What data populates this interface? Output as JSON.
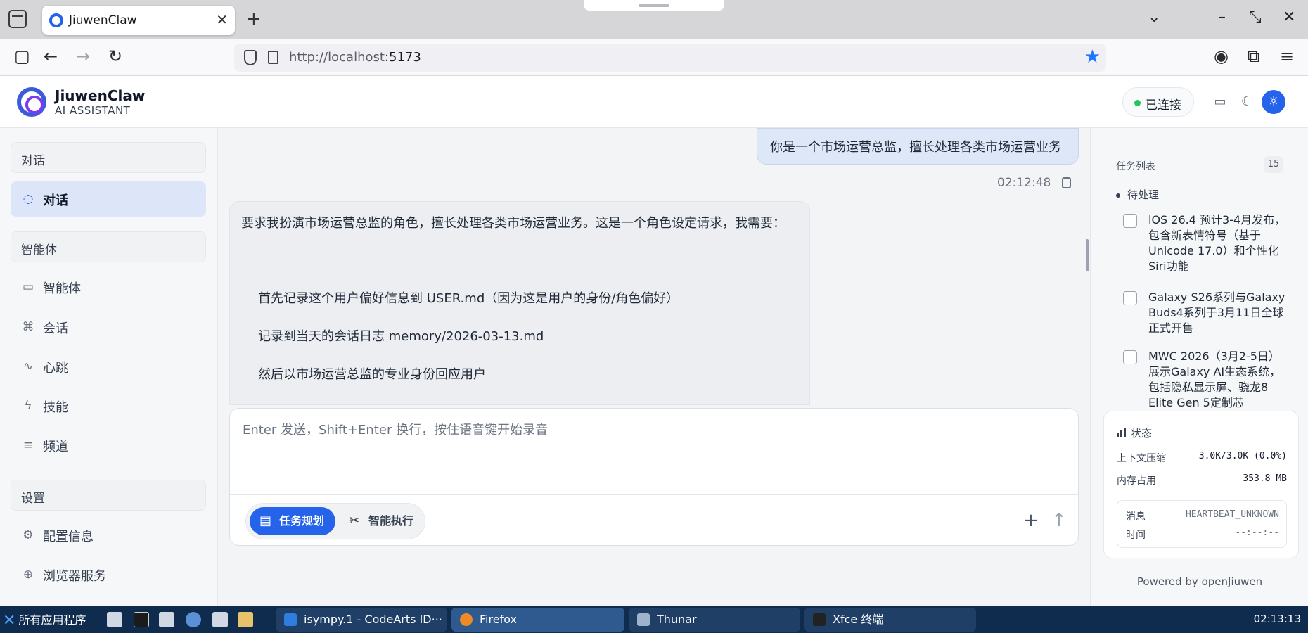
{
  "browser": {
    "tab_title": "JiuwenClaw",
    "url_host": "http://localhost",
    "url_port": ":5173"
  },
  "header": {
    "brand": "JiuwenClaw",
    "brand_sub": "AI ASSISTANT",
    "connection_status": "已连接",
    "status_color": "#22c55e",
    "accent_color": "#2563eb"
  },
  "sidebar": {
    "section_chat": "对话",
    "chat_item": "对话",
    "section_agents": "智能体",
    "agent_items": [
      "智能体",
      "会话",
      "心跳",
      "技能",
      "频道"
    ],
    "section_settings": "设置",
    "settings_items": [
      "配置信息",
      "浏览器服务"
    ]
  },
  "chat": {
    "user_message": "你是一个市场运营总监，擅长处理各类市场运营业务",
    "user_message_time": "02:12:48",
    "assistant_lines": [
      "要求我扮演市场运营总监的角色，擅长处理各类市场运营业务。这是一个角色设定请求，我需要：",
      "首先记录这个用户偏好信息到 USER.md（因为这是用户的身份/角色偏好）",
      "记录到当天的会话日志 memory/2026-03-13.md",
      "然后以市场运营总监的专业身份回应用户"
    ]
  },
  "composer": {
    "placeholder": "Enter 发送，Shift+Enter 换行，按住语音键开始录音",
    "mode_plan": "任务规划",
    "mode_exec": "智能执行"
  },
  "tasks": {
    "title": "任务列表",
    "count": "15",
    "group": "待处理",
    "items": [
      "iOS 26.4 预计3-4月发布，包含新表情符号（基于Unicode 17.0）和个性化Siri功能",
      "Galaxy S26系列与Galaxy Buds4系列于3月11日全球正式开售",
      "MWC 2026（3月2-5日）展示Galaxy AI生态系统，包括隐私显示屏、骁龙8 Elite Gen 5定制芯"
    ]
  },
  "status": {
    "title": "状态",
    "context_label": "上下文压缩",
    "context_value": "3.0K/3.0K (0.0%)",
    "memory_label": "内存占用",
    "memory_value": "353.8 MB",
    "message_label": "消息",
    "message_value": "HEARTBEAT_UNKNOWN",
    "time_label": "时间",
    "time_value": "--:--:--"
  },
  "powered_by": "Powered by openJiuwen",
  "taskbar": {
    "start_label": "所有应用程序",
    "tasks": [
      "isympy.1 - CodeArts ID···",
      "Firefox",
      "Thunar",
      "Xfce 终端"
    ],
    "clock": "02:13:13"
  }
}
